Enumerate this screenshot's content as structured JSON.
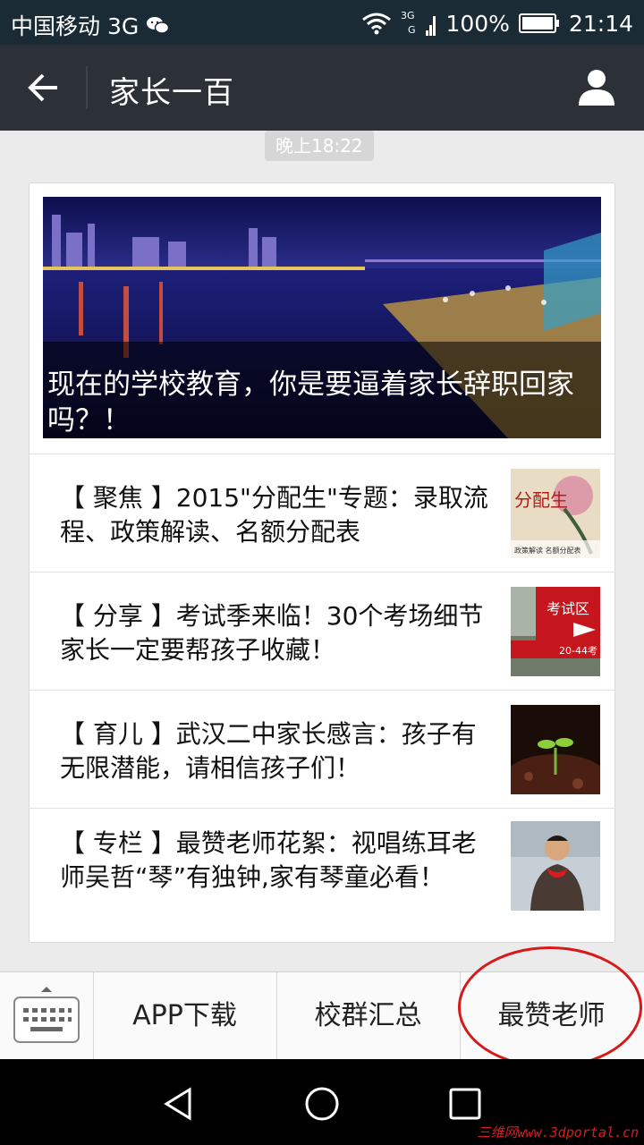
{
  "status_bar": {
    "carrier": "中国移动 3G",
    "network_badge_top": "3G",
    "network_badge_bottom": "G",
    "battery": "100%",
    "time": "21:14"
  },
  "header": {
    "title": "家长一百"
  },
  "chat": {
    "timestamp": "晚上18:22",
    "hero": {
      "title": "现在的学校教育，你是要逼着家长辞职回家吗？！"
    },
    "articles": [
      {
        "title": "【 聚焦 】2015\"分配生\"专题：录取流程、政策解读、名额分配表",
        "thumb_text": "分配生",
        "thumb_sub": "政策解读 名额分配表"
      },
      {
        "title": "【 分享 】考试季来临！30个考场细节家长一定要帮孩子收藏！",
        "thumb_text": "考试区",
        "thumb_sub": "20-44考"
      },
      {
        "title": "【 育儿 】武汉二中家长感言：孩子有无限潜能，请相信孩子们！"
      },
      {
        "title": "【 专栏 】最赞老师花絮：视唱练耳老师吴哲“琴”有独钟,家有琴童必看！"
      }
    ]
  },
  "menu": {
    "items": [
      "APP下载",
      "校群汇总",
      "最赞老师"
    ]
  },
  "watermark": "三维网www.3dportal.cn",
  "icons": {
    "back": "arrow-left-icon",
    "profile": "person-icon",
    "keyboard": "keyboard-icon",
    "nav_back": "triangle-back-icon",
    "nav_home": "circle-home-icon",
    "nav_recent": "square-recent-icon"
  }
}
